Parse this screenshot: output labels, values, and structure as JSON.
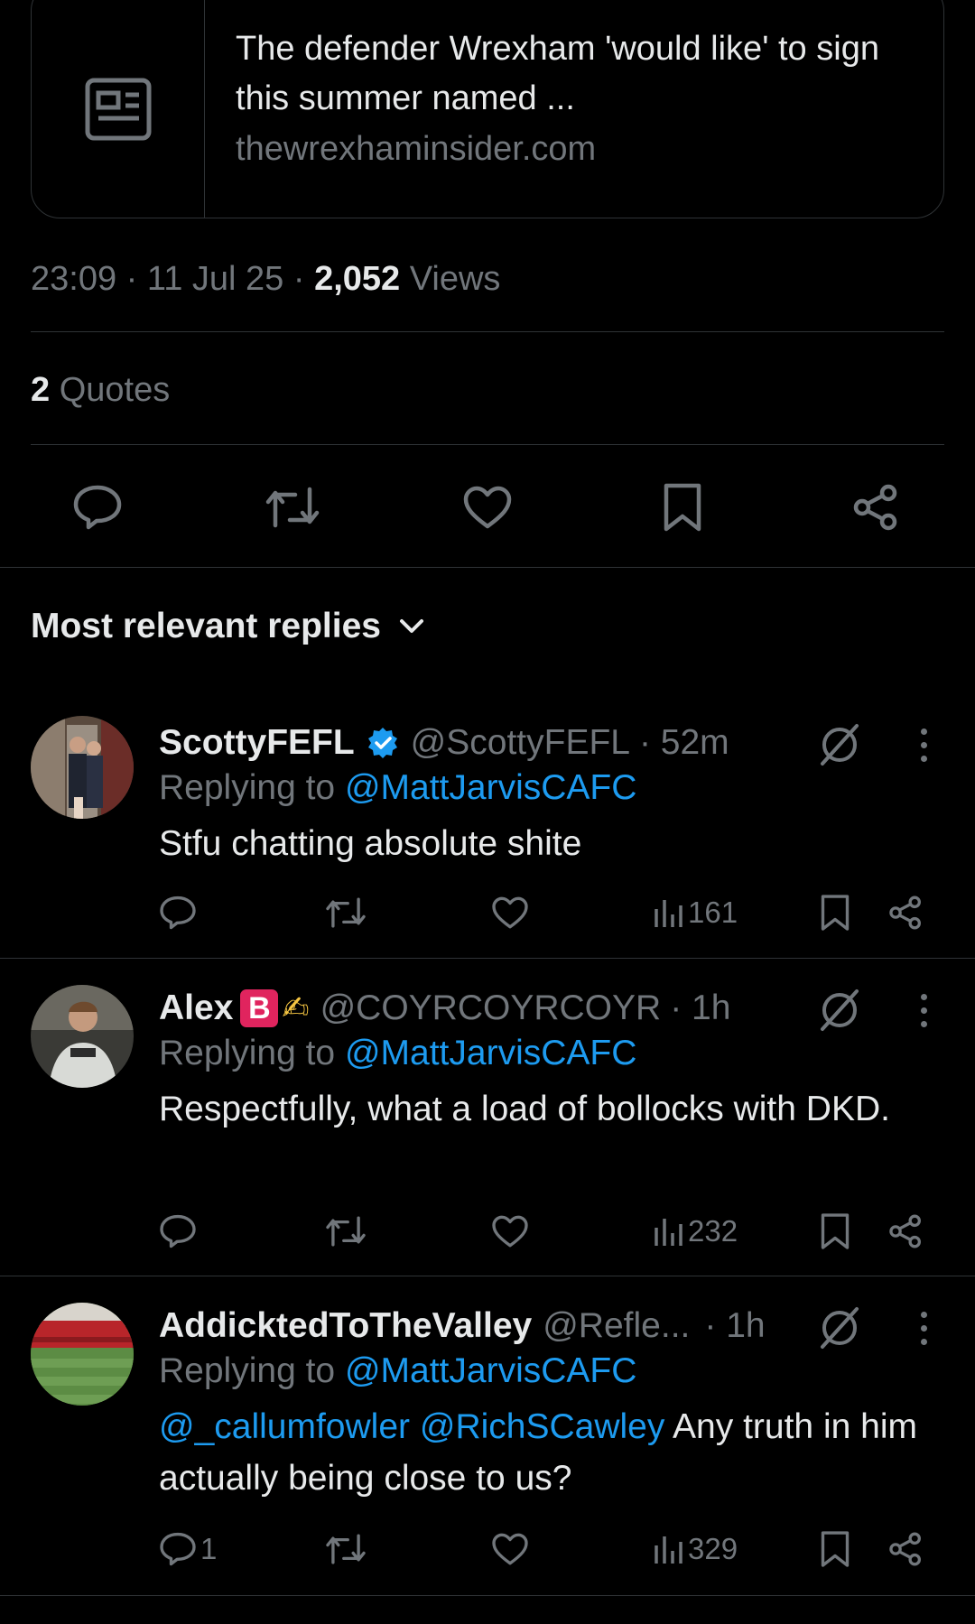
{
  "link_card": {
    "title": "The defender Wrexham 'would like' to sign this summer named ...",
    "domain": "thewrexhaminsider.com",
    "icon": "newspaper-icon"
  },
  "post_meta": {
    "time": "23:09",
    "date": "11 Jul 25",
    "views_count": "2,052",
    "views_label": "Views",
    "separator": "·"
  },
  "quotes": {
    "count": "2",
    "label": "Quotes"
  },
  "actions": [
    "reply-icon",
    "repost-icon",
    "like-icon",
    "bookmark-icon",
    "share-icon"
  ],
  "replies_section": {
    "label": "Most relevant replies",
    "icon": "chevron-down-icon"
  },
  "replies": [
    {
      "name": "ScottyFEFL",
      "verified": true,
      "handle": "@ScottyFEFL",
      "time": "· 52m",
      "replying_prefix": "Replying to ",
      "replying_to": "@MattJarvisCAFC",
      "text": "Stfu chatting absolute shite",
      "reply_count": "",
      "views": "161"
    },
    {
      "name": "Alex",
      "badge": "B",
      "emoji": "✍",
      "handle": "@COYRCOYRCOYR",
      "time": "· 1h",
      "replying_prefix": "Replying to ",
      "replying_to": "@MattJarvisCAFC",
      "text": "Respectfully, what a load of bollocks with DKD.",
      "reply_count": "",
      "views": "232"
    },
    {
      "name": "AddicktedToTheValley",
      "handle": "@Refle...",
      "time": "· 1h",
      "replying_prefix": "Replying to ",
      "replying_to": "@MattJarvisCAFC",
      "mention1": "@_callumfowler",
      "mention2": "@RichSCawley",
      "text": " Any truth in him actually being close to us?",
      "reply_count": "1",
      "views": "329"
    }
  ],
  "colors": {
    "background": "#000000",
    "text": "#e7e9ea",
    "muted": "#71767b",
    "link": "#1d9bf0",
    "divider": "#2f3336"
  }
}
